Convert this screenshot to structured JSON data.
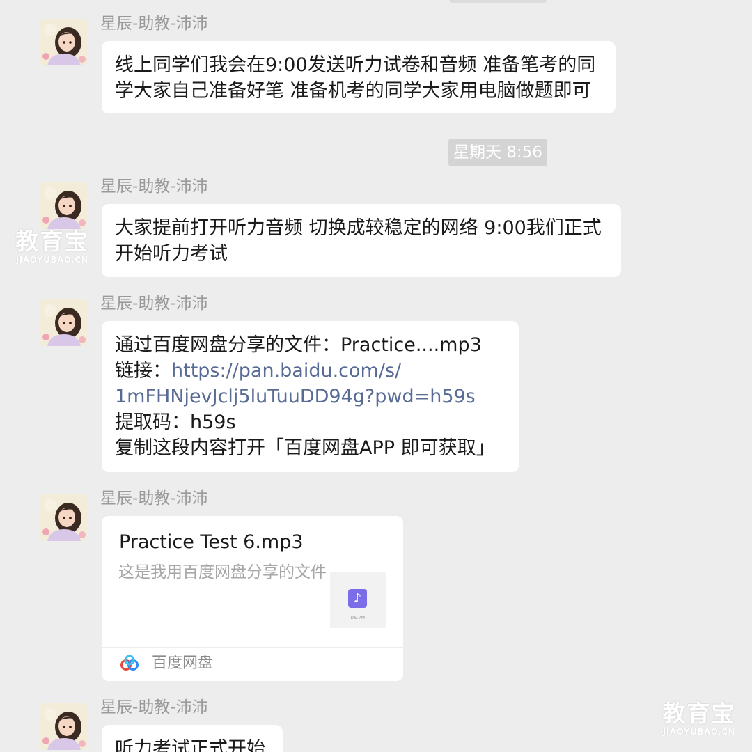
{
  "timestamps": {
    "divider": "星期天 8:56"
  },
  "messages": [
    {
      "sender": "星辰-助教-沛沛",
      "lines": [
        "线上同学们我会在9:00发送听力试卷和音频 准备笔考的同",
        "学大家自己准备好笔 准备机考的同学大家用电脑做题即可"
      ]
    },
    {
      "sender": "星辰-助教-沛沛",
      "lines": [
        "大家提前打开听力音频 切换成较稳定的网络 9:00我们正式",
        "开始听力考试"
      ]
    },
    {
      "sender": "星辰-助教-沛沛",
      "share_line": "通过百度网盘分享的文件：Practice....mp3",
      "link_prefix": "链接：",
      "link_line1": "https://pan.baidu.com/s/",
      "link_line2": "1mFHNjevJclj5luTuuDD94g?pwd=h59s",
      "code_line": "提取码：h59s",
      "copy_line": "复制这段内容打开「百度网盘APP 即可获取」"
    },
    {
      "sender": "星辰-助教-沛沛",
      "card": {
        "title": "Practice Test 6.mp3",
        "description": "这是我用百度网盘分享的文件",
        "thumb_icon": "music-note-icon",
        "thumb_tag": "DS.?M",
        "source": "百度网盘",
        "source_icon": "baidu-netdisk-icon"
      }
    },
    {
      "sender": "星辰-助教-沛沛",
      "lines": [
        "听力考试正式开始"
      ]
    }
  ],
  "watermark": {
    "main": "教育宝",
    "sub": "JIAOYUBAO.CN"
  },
  "colors": {
    "background": "#ededed",
    "bubble": "#ffffff",
    "link": "#576b95",
    "sender": "#9a9a9a",
    "music_tile": "#7b6ce8"
  }
}
